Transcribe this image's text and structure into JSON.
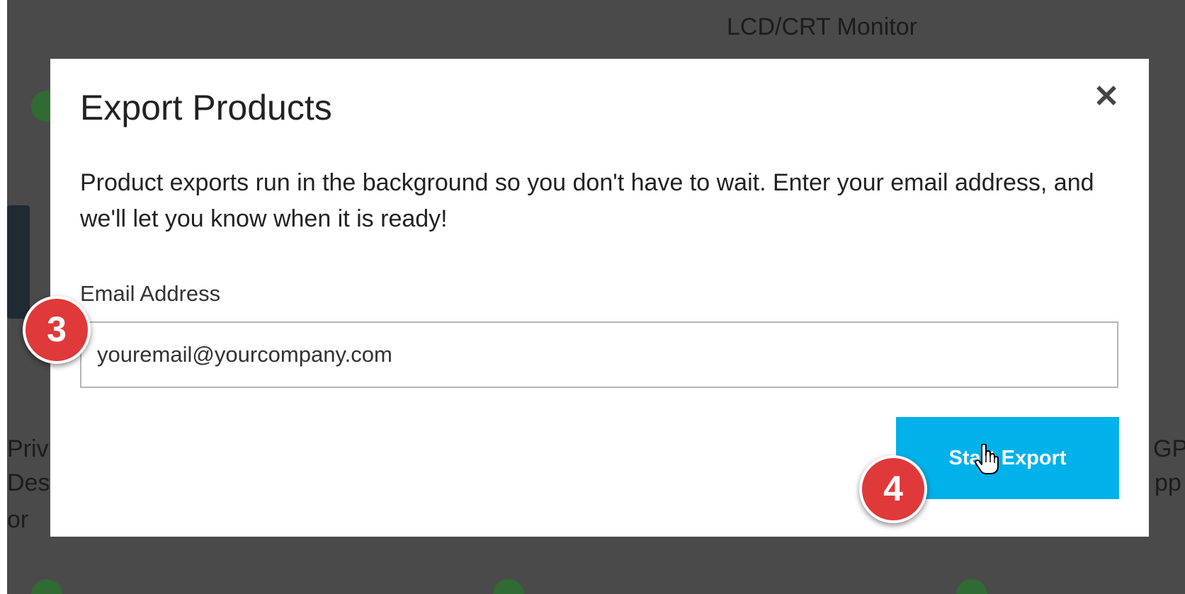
{
  "background": {
    "product_top_title": "LCD/CRT Monitor",
    "left_fragments": [
      "Priv",
      "Des",
      "or"
    ],
    "right_fragments": [
      "GP",
      "pp"
    ]
  },
  "modal": {
    "title": "Export Products",
    "description": "Product exports run in the background so you don't have to wait. Enter your email address, and we'll let you know when it is ready!",
    "email_label": "Email Address",
    "email_value": "youremail@yourcompany.com",
    "close_symbol": "✕",
    "start_button_label": "Start Export"
  },
  "annotations": {
    "step3": "3",
    "step4": "4"
  },
  "colors": {
    "button": "#00b1ea",
    "badge": "#e0393a",
    "overlay": "#4a4a4a"
  },
  "icons": {
    "close": "close-icon",
    "check": "check-circle-icon",
    "cursor": "hand-pointer-icon"
  }
}
